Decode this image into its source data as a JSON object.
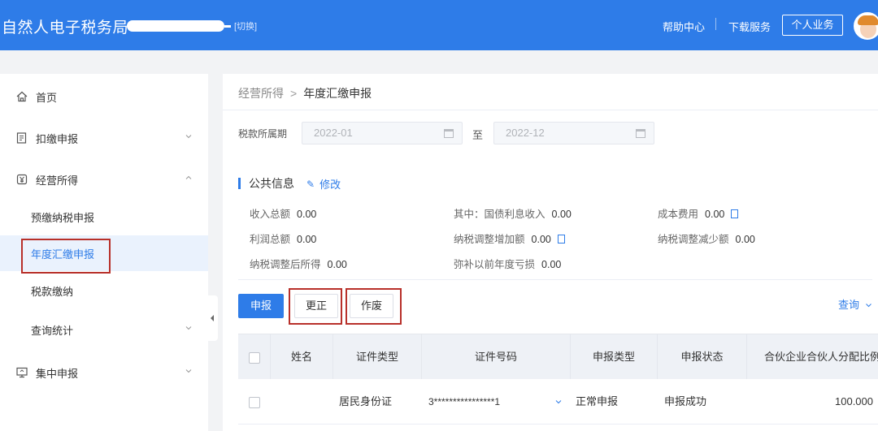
{
  "header": {
    "title": "自然人电子税务局",
    "switch_label": "[切换]",
    "help": "帮助中心",
    "download": "下载服务",
    "personal": "个人业务"
  },
  "sidebar": {
    "items": [
      {
        "label": "首页"
      },
      {
        "label": "扣缴申报"
      },
      {
        "label": "经营所得"
      },
      {
        "label": "查询统计"
      },
      {
        "label": "集中申报"
      }
    ],
    "sub_items": [
      {
        "label": "预缴纳税申报"
      },
      {
        "label": "年度汇缴申报"
      },
      {
        "label": "税款缴纳"
      }
    ]
  },
  "breadcrumb": {
    "parent": "经营所得",
    "separator": ">",
    "current": "年度汇缴申报"
  },
  "filter": {
    "period_label": "税款所属期",
    "start": "2022-01",
    "to_label": "至",
    "end": "2022-12"
  },
  "public_info": {
    "title": "公共信息",
    "edit_label": "修改",
    "fields": [
      {
        "label": "收入总额",
        "value": "0.00"
      },
      {
        "label": "其中：国债利息收入",
        "value": "0.00"
      },
      {
        "label": "成本费用",
        "value": "0.00"
      },
      {
        "label": "利润总额",
        "value": "0.00"
      },
      {
        "label": "纳税调整增加额",
        "value": "0.00"
      },
      {
        "label": "纳税调整减少额",
        "value": "0.00"
      },
      {
        "label": "纳税调整后所得",
        "value": "0.00"
      },
      {
        "label": "弥补以前年度亏损",
        "value": "0.00"
      }
    ]
  },
  "actions": {
    "declare": "申报",
    "correct": "更正",
    "cancel": "作废",
    "query": "查询"
  },
  "table": {
    "headers": [
      "姓名",
      "证件类型",
      "证件号码",
      "申报类型",
      "申报状态",
      "合伙企业合伙人分配比例"
    ],
    "rows": [
      {
        "name": "",
        "id_type": "居民身份证",
        "id_number": "3****************1",
        "declare_type": "正常申报",
        "status": "申报成功",
        "ratio": "100.000"
      }
    ]
  },
  "colors": {
    "brand": "#2e7ce8",
    "highlight": "#b8302a"
  }
}
